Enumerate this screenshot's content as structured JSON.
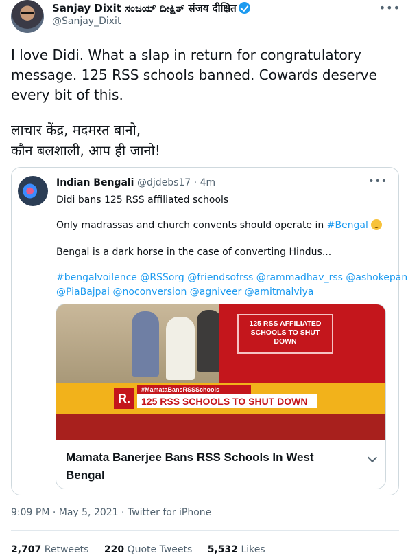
{
  "author": {
    "name": "Sanjay Dixit ಸಂಜಯ್ ದೀಕ್ಷಿತ್ संजय दीक्षित",
    "handle": "@Sanjay_Dixit",
    "verified": true
  },
  "tweet": {
    "text": "I love Didi. What a slap in return for congratulatory message. 125 RSS schools banned. Cowards deserve every bit of this.",
    "hindi_line1": "लाचार केंद्र, मदमस्त बानो,",
    "hindi_line2": "कौन बलशाली, आप ही जानो!"
  },
  "quoted": {
    "name": "Indian Bengali",
    "handle": "@djdebs17",
    "time": "· 4m",
    "line1": "Didi bans 125 RSS affiliated schools",
    "line2_prefix": "Only madrassas and church convents should operate in",
    "line2_hashtag": "#Bengal",
    "line3": "Bengal is a dark horse in the case of converting Hindus...",
    "hashtags_line1": "#bengalvoilence @RSSorg @friendsofrss @rammadhav_rss @ashokepandit",
    "hashtags_line2": "@PiaBajpai @noconversion @agniveer @amitmalviya",
    "card": {
      "image_box_text": "125 RSS AFFILIATED SCHOOLS TO SHUT DOWN",
      "image_tag": "#MamataBansRSSSchools",
      "image_headline": "125 RSS SCHOOLS TO SHUT DOWN",
      "image_logo": "R.",
      "title": "Mamata Banerjee Bans RSS Schools In West Bengal"
    }
  },
  "meta": {
    "timestamp": "9:09 PM · May 5, 2021 · Twitter for iPhone"
  },
  "stats": {
    "retweets_count": "2,707",
    "retweets_label": "Retweets",
    "quotes_count": "220",
    "quotes_label": "Quote Tweets",
    "likes_count": "5,532",
    "likes_label": "Likes"
  },
  "colors": {
    "accent": "#1d9bf0",
    "text": "#0f1419",
    "muted": "#536471",
    "border": "#cfd9de"
  }
}
